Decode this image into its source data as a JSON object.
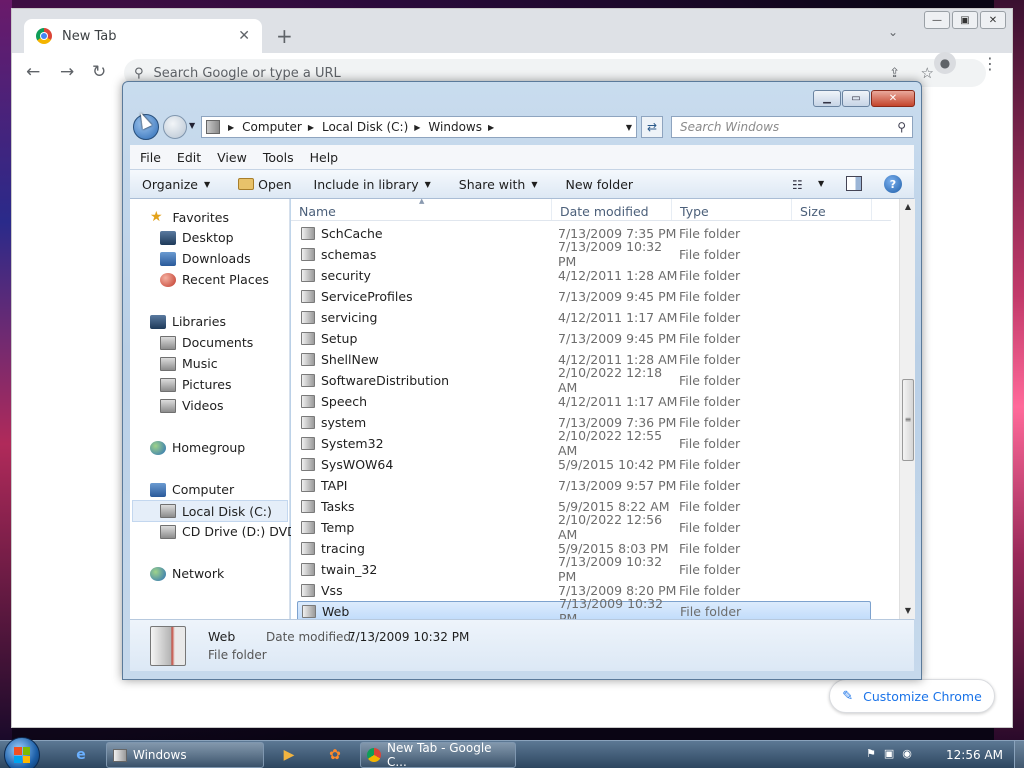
{
  "chrome": {
    "tab_title": "New Tab",
    "tab_close": "✕",
    "new_tab": "+",
    "tab_search": "⌄",
    "omnibox_placeholder": "Search Google or type a URL",
    "customize_label": "Customize Chrome"
  },
  "explorer": {
    "breadcrumbs": [
      "Computer",
      "Local Disk (C:)",
      "Windows"
    ],
    "search_placeholder": "Search Windows",
    "menu": [
      "File",
      "Edit",
      "View",
      "Tools",
      "Help"
    ],
    "commands": {
      "organize": "Organize",
      "open": "Open",
      "include": "Include in library",
      "share": "Share with",
      "new_folder": "New folder"
    },
    "nav": {
      "favorites": "Favorites",
      "desktop": "Desktop",
      "downloads": "Downloads",
      "recent": "Recent Places",
      "libraries": "Libraries",
      "documents": "Documents",
      "music": "Music",
      "pictures": "Pictures",
      "videos": "Videos",
      "homegroup": "Homegroup",
      "computer": "Computer",
      "local_disk": "Local Disk (C:)",
      "cd_drive": "CD Drive (D:) DVD",
      "network": "Network"
    },
    "columns": {
      "name": "Name",
      "date": "Date modified",
      "type": "Type",
      "size": "Size"
    },
    "files": [
      {
        "name": "SchCache",
        "date": "7/13/2009 7:35 PM",
        "type": "File folder"
      },
      {
        "name": "schemas",
        "date": "7/13/2009 10:32 PM",
        "type": "File folder"
      },
      {
        "name": "security",
        "date": "4/12/2011 1:28 AM",
        "type": "File folder"
      },
      {
        "name": "ServiceProfiles",
        "date": "7/13/2009 9:45 PM",
        "type": "File folder"
      },
      {
        "name": "servicing",
        "date": "4/12/2011 1:17 AM",
        "type": "File folder"
      },
      {
        "name": "Setup",
        "date": "7/13/2009 9:45 PM",
        "type": "File folder"
      },
      {
        "name": "ShellNew",
        "date": "4/12/2011 1:28 AM",
        "type": "File folder"
      },
      {
        "name": "SoftwareDistribution",
        "date": "2/10/2022 12:18 AM",
        "type": "File folder"
      },
      {
        "name": "Speech",
        "date": "4/12/2011 1:17 AM",
        "type": "File folder"
      },
      {
        "name": "system",
        "date": "7/13/2009 7:36 PM",
        "type": "File folder"
      },
      {
        "name": "System32",
        "date": "2/10/2022 12:55 AM",
        "type": "File folder"
      },
      {
        "name": "SysWOW64",
        "date": "5/9/2015 10:42 PM",
        "type": "File folder"
      },
      {
        "name": "TAPI",
        "date": "7/13/2009 9:57 PM",
        "type": "File folder"
      },
      {
        "name": "Tasks",
        "date": "5/9/2015 8:22 AM",
        "type": "File folder"
      },
      {
        "name": "Temp",
        "date": "2/10/2022 12:56 AM",
        "type": "File folder"
      },
      {
        "name": "tracing",
        "date": "5/9/2015 8:03 PM",
        "type": "File folder"
      },
      {
        "name": "twain_32",
        "date": "7/13/2009 10:32 PM",
        "type": "File folder"
      },
      {
        "name": "Vss",
        "date": "7/13/2009 8:20 PM",
        "type": "File folder"
      },
      {
        "name": "Web",
        "date": "7/13/2009 10:32 PM",
        "type": "File folder"
      }
    ],
    "details": {
      "name": "Web",
      "date_label": "Date modified:",
      "date_value": "7/13/2009 10:32 PM",
      "type": "File folder"
    }
  },
  "taskbar": {
    "explorer_label": "Windows",
    "chrome_label": "New Tab - Google C...",
    "clock": "12:56 AM"
  },
  "icons": [
    "chrome-logo-icon",
    "search-icon",
    "share-icon",
    "star-icon",
    "profile-icon",
    "menu-icon",
    "back-icon",
    "forward-icon",
    "refresh-icon",
    "folder-icon",
    "help-icon",
    "start-orb-icon",
    "ie-icon",
    "media-player-icon"
  ]
}
